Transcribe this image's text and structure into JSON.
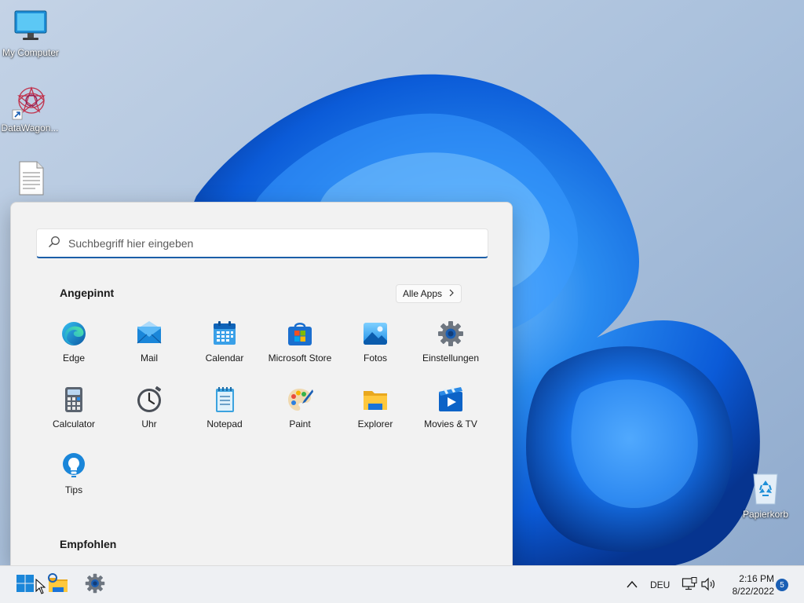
{
  "desktop": {
    "icons": [
      {
        "label": "My Computer"
      },
      {
        "label": "DataWagon..."
      },
      {
        "label": ""
      },
      {
        "label": "Papierkorb"
      }
    ]
  },
  "start_menu": {
    "search": {
      "placeholder": "Suchbegriff hier eingeben"
    },
    "pinned": {
      "title": "Angepinnt",
      "all_apps_label": "Alle Apps",
      "apps": [
        {
          "label": "Edge",
          "icon": "edge-icon"
        },
        {
          "label": "Mail",
          "icon": "mail-icon"
        },
        {
          "label": "Calendar",
          "icon": "calendar-icon"
        },
        {
          "label": "Microsoft Store",
          "icon": "store-icon"
        },
        {
          "label": "Fotos",
          "icon": "photos-icon"
        },
        {
          "label": "Einstellungen",
          "icon": "settings-gear-icon"
        },
        {
          "label": "Calculator",
          "icon": "calculator-icon"
        },
        {
          "label": "Uhr",
          "icon": "clock-icon"
        },
        {
          "label": "Notepad",
          "icon": "notepad-icon"
        },
        {
          "label": "Paint",
          "icon": "paint-palette-icon"
        },
        {
          "label": "Explorer",
          "icon": "folder-icon"
        },
        {
          "label": "Movies & TV",
          "icon": "movies-play-icon"
        },
        {
          "label": "Tips",
          "icon": "lightbulb-icon"
        }
      ]
    },
    "recommended": {
      "title": "Empfohlen"
    }
  },
  "taskbar": {
    "language": "DEU",
    "time": "2:16 PM",
    "date": "8/22/2022",
    "notification_count": "5"
  },
  "colors": {
    "accent": "#1b5ea8",
    "start_menu_bg": "#f2f2f2",
    "taskbar_bg": "#eef0f3",
    "badge": "#1a5fb4"
  }
}
